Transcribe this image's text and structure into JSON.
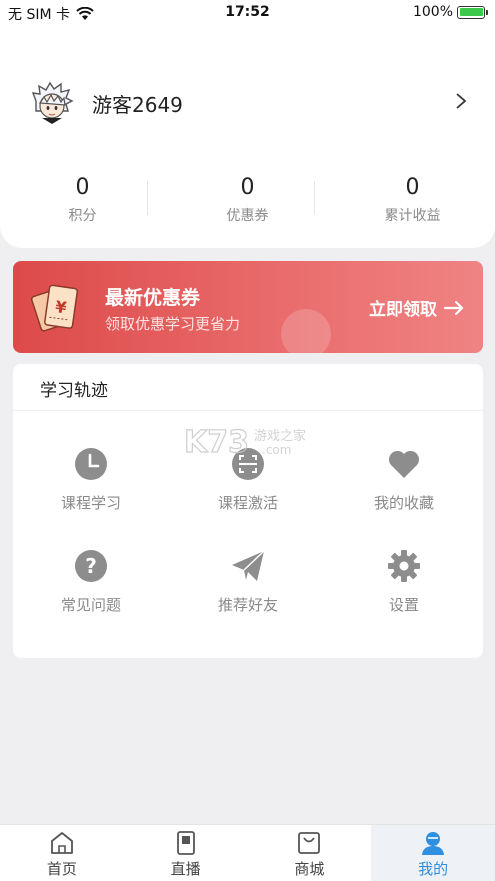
{
  "status_bar": {
    "carrier": "无 SIM 卡",
    "time": "17:52",
    "battery": "100%",
    "battery_level": 1.0
  },
  "profile": {
    "username": "游客2649",
    "avatar_icon": "cartoon-avatar-icon",
    "stats": [
      {
        "value": "0",
        "label": "积分"
      },
      {
        "value": "0",
        "label": "优惠券"
      },
      {
        "value": "0",
        "label": "累计收益"
      }
    ]
  },
  "coupon_banner": {
    "title": "最新优惠券",
    "subtitle": "领取优惠学习更省力",
    "action": "立即领取",
    "icon": "coupon-ticket-icon",
    "colors": {
      "start": "#dd4a4a",
      "end": "#ef8383"
    }
  },
  "learning_track": {
    "title": "学习轨迹",
    "items": [
      {
        "label": "课程学习",
        "icon": "clock-icon"
      },
      {
        "label": "课程激活",
        "icon": "scan-icon"
      },
      {
        "label": "我的收藏",
        "icon": "heart-icon"
      },
      {
        "label": "常见问题",
        "icon": "question-icon"
      },
      {
        "label": "推荐好友",
        "icon": "paper-plane-icon"
      },
      {
        "label": "设置",
        "icon": "gear-icon"
      }
    ]
  },
  "tabbar": {
    "tabs": [
      {
        "label": "首页",
        "icon": "home-icon",
        "active": false
      },
      {
        "label": "直播",
        "icon": "live-icon",
        "active": false
      },
      {
        "label": "商城",
        "icon": "shop-icon",
        "active": false
      },
      {
        "label": "我的",
        "icon": "user-icon",
        "active": true
      }
    ],
    "active_color": "#2f8fe0"
  },
  "watermark": {
    "brand": "K73",
    "text": "游戏之家",
    "domain": ".com"
  }
}
